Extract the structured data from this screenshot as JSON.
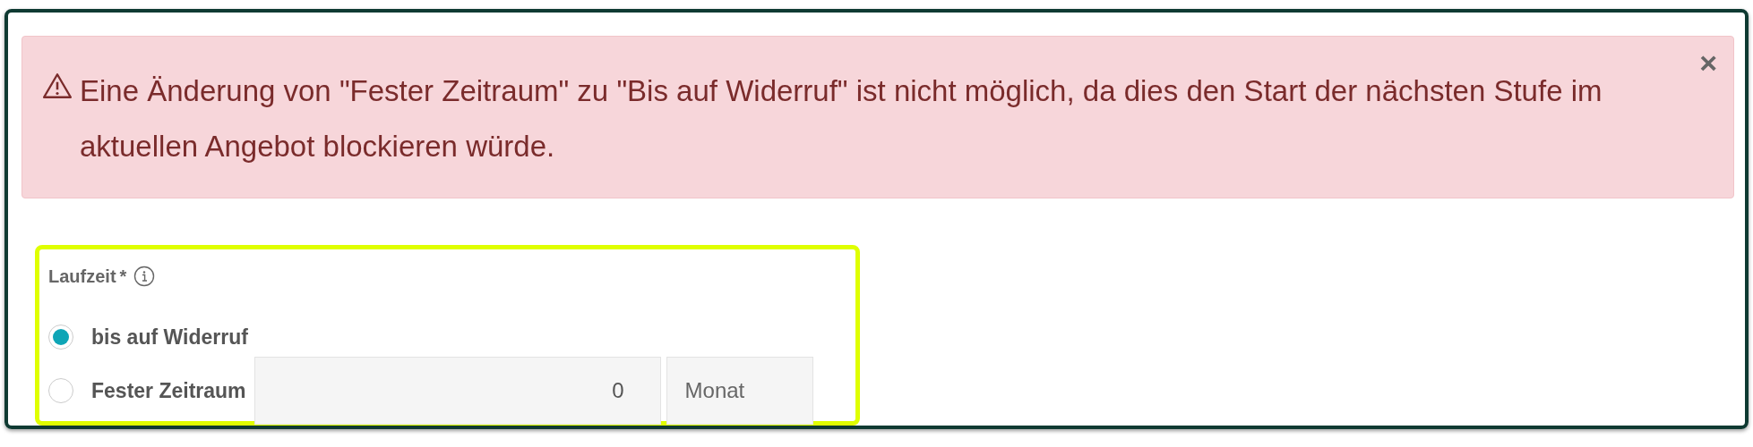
{
  "alert": {
    "message": "Eine Änderung von \"Fester Zeitraum\" zu \"Bis auf Widerruf\" ist nicht möglich, da dies den Start der nächsten Stufe im aktuellen Angebot blockieren würde.",
    "close": "×"
  },
  "field": {
    "label": "Laufzeit",
    "required_mark": "*",
    "highlighted": true,
    "options": [
      {
        "label": "bis auf Widerruf",
        "selected": true
      },
      {
        "label": "Fester Zeitraum",
        "selected": false
      }
    ],
    "duration": {
      "value": "0",
      "unit": "Monat"
    }
  }
}
